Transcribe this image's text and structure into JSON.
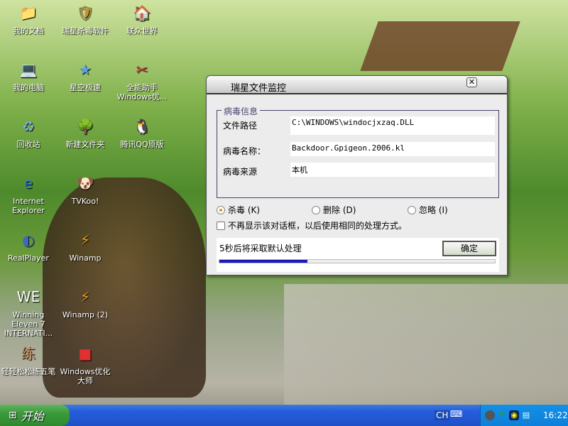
{
  "desktop": {
    "icons": [
      {
        "label": "我的文档",
        "glyph": "📁",
        "color": "#f0c040"
      },
      {
        "label": "瑞星杀毒软件",
        "glyph": "🛡",
        "color": "#c8902a"
      },
      {
        "label": "联众世界",
        "glyph": "🏠",
        "color": "#d08030"
      },
      {
        "label": "我的电脑",
        "glyph": "💻",
        "color": "#6aa0e0"
      },
      {
        "label": "星空极速",
        "glyph": "★",
        "color": "#5aa0e8"
      },
      {
        "label": "全能助手 Windows优...",
        "glyph": "✂",
        "color": "#d04040"
      },
      {
        "label": "回收站",
        "glyph": "♻",
        "color": "#7ab0d0"
      },
      {
        "label": "新建文件夹",
        "glyph": "🌳",
        "color": "#3a8a2a"
      },
      {
        "label": "腾讯QQ原版",
        "glyph": "🐧",
        "color": "#222"
      },
      {
        "label": "Internet Explorer",
        "glyph": "e",
        "color": "#2a80d8"
      },
      {
        "label": "TVKoo!",
        "glyph": "🐶",
        "color": "#c89050"
      },
      {
        "label": "",
        "glyph": "",
        "color": ""
      },
      {
        "label": "RealPlayer",
        "glyph": "◐",
        "color": "#3a6ac0"
      },
      {
        "label": "Winamp",
        "glyph": "⚡",
        "color": "#e8a020"
      },
      {
        "label": "",
        "glyph": "",
        "color": ""
      },
      {
        "label": "Winning Eleven 7 INTERNATI...",
        "glyph": "WE",
        "color": "#fff"
      },
      {
        "label": "Winamp (2)",
        "glyph": "⚡",
        "color": "#e8a020"
      },
      {
        "label": "",
        "glyph": "",
        "color": ""
      },
      {
        "label": "轻轻松松练五笔",
        "glyph": "练",
        "color": "#c89060"
      },
      {
        "label": "Windows优化大师",
        "glyph": "■",
        "color": "#e03030"
      }
    ]
  },
  "dialog": {
    "title": "瑞星文件监控",
    "close": "✕",
    "group_title": "病毒信息",
    "file_path_label": "文件路径",
    "file_path": "C:\\WINDOWS\\windocjxzaq.DLL",
    "virus_name_label": "病毒名称：",
    "virus_name": "Backdoor.Gpigeon.2006.kl",
    "source_label": "病毒来源",
    "source": "本机",
    "options": [
      "杀毒 (K)",
      "删除 (D)",
      "忽略 (I)"
    ],
    "selected_option": 0,
    "dont_show": "不再显示该对话框，以后使用相同的处理方式。",
    "countdown": "5秒后将采取默认处理",
    "ok": "确定",
    "progress_percent": 32
  },
  "taskbar": {
    "start": "开始",
    "lang": "CH",
    "time": "16:22"
  }
}
